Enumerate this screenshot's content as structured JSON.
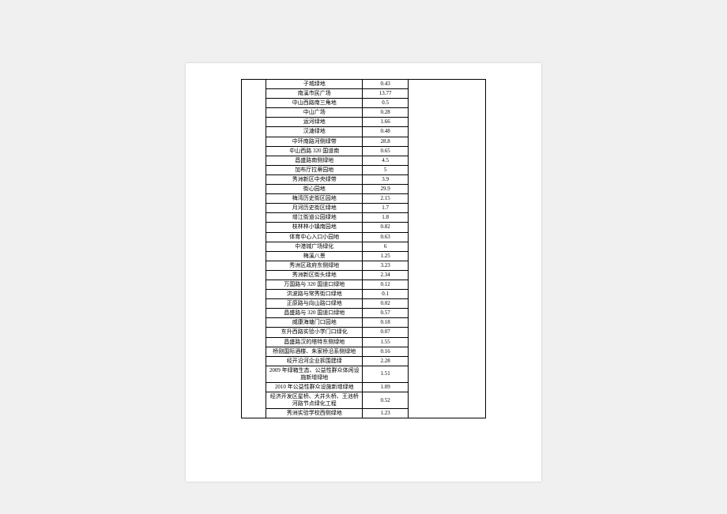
{
  "rows": [
    {
      "name": "子城绿地",
      "val": "0.43"
    },
    {
      "name": "南溪市民广场",
      "val": "13.77"
    },
    {
      "name": "中山西路南三角地",
      "val": "0.5"
    },
    {
      "name": "中山广场",
      "val": "0.28"
    },
    {
      "name": "运河绿地",
      "val": "1.66"
    },
    {
      "name": "汉溏绿地",
      "val": "0.48"
    },
    {
      "name": "中环南路河侧绿带",
      "val": "28.8"
    },
    {
      "name": "中山西路 320 国道南",
      "val": "0.65"
    },
    {
      "name": "昌盛路南侧绿地",
      "val": "4.5"
    },
    {
      "name": "加布厅拉蒂园地",
      "val": "5"
    },
    {
      "name": "秀洲新区中央绿带",
      "val": "3.9"
    },
    {
      "name": "街心园地",
      "val": "29.9"
    },
    {
      "name": "梅湾历史街区园地",
      "val": "2.15"
    },
    {
      "name": "月河历史街区绿地",
      "val": "1.7"
    },
    {
      "name": "增江街道公园绿地",
      "val": "1.8"
    },
    {
      "name": "枝林林小镇南园地",
      "val": "0.82"
    },
    {
      "name": "体育中心入口小园地",
      "val": "0.63"
    },
    {
      "name": "中港城广场绿化",
      "val": "6"
    },
    {
      "name": "梅溪八景",
      "val": "1.25"
    },
    {
      "name": "秀洲区政府东侧绿地",
      "val": "3.23"
    },
    {
      "name": "秀洲新区街头绿地",
      "val": "2.34"
    },
    {
      "name": "万国路与 320 国道口绿地",
      "val": "0.12"
    },
    {
      "name": "洪波路与常秀街口绿地",
      "val": "0.1"
    },
    {
      "name": "正原路与向山路口绿地",
      "val": "0.02"
    },
    {
      "name": "昌盛路与 320 国道口绿地",
      "val": "0.57"
    },
    {
      "name": "威康海塘门口园地",
      "val": "0.18"
    },
    {
      "name": "东升西路实验小学门口绿化",
      "val": "0.07"
    },
    {
      "name": "昌盛路汉的塔特东侧绿地",
      "val": "1.55"
    },
    {
      "name": "桥刚国际酒楼、朱家桥沿系侧绿地",
      "val": "0.16"
    },
    {
      "name": "经开沿河企业拆围建绿",
      "val": "2.28"
    },
    {
      "name": "2009 年绿箱生态、公益性群众体闲设施新增绿地",
      "val": "1.51"
    },
    {
      "name": "2010 年公益性群众设施新增绿地",
      "val": "1.09"
    },
    {
      "name": "经济开发区星桥、大井头桥、王池桥河路节点绿化工程",
      "val": "0.52"
    },
    {
      "name": "秀洲实验学校西侧绿地",
      "val": "1.23"
    }
  ]
}
